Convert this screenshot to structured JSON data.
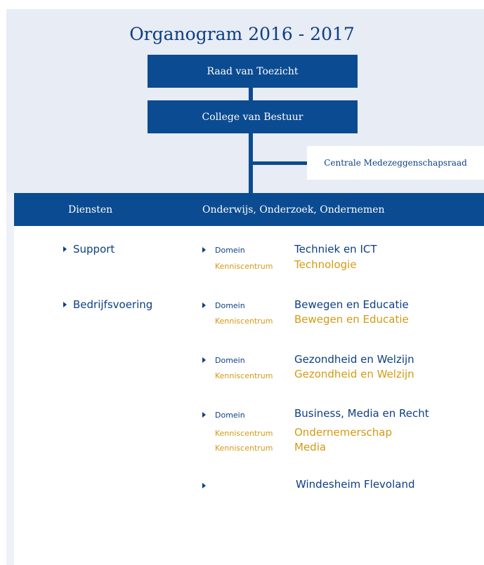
{
  "title": "Organogram 2016 - 2017",
  "boxes": {
    "raad": "Raad van Toezicht",
    "college": "College van Bestuur",
    "cmr": "Centrale Medezeggenschapsraad"
  },
  "band": {
    "left": "Diensten",
    "right": "Onderwijs, Onderzoek, Ondernemen"
  },
  "services": [
    "Support",
    "Bedrijfsvoering"
  ],
  "domains": [
    {
      "domain_label": "Domein",
      "domain_name": "Techniek en ICT",
      "kc": [
        {
          "label": "Kenniscentrum",
          "name": "Technologie"
        }
      ]
    },
    {
      "domain_label": "Domein",
      "domain_name": "Bewegen en Educatie",
      "kc": [
        {
          "label": "Kenniscentrum",
          "name": "Bewegen en Educatie"
        }
      ]
    },
    {
      "domain_label": "Domein",
      "domain_name": "Gezondheid en Welzijn",
      "kc": [
        {
          "label": "Kenniscentrum",
          "name": "Gezondheid en Welzijn"
        }
      ]
    },
    {
      "domain_label": "Domein",
      "domain_name": "Business, Media en Recht",
      "kc": [
        {
          "label": "Kenniscentrum",
          "name": "Ondernemerschap"
        },
        {
          "label": "Kenniscentrum",
          "name": "Media"
        }
      ]
    }
  ],
  "extra": {
    "name": "Windesheim Flevoland"
  },
  "colors": {
    "navy": "#0b4b91",
    "gold": "#d39a12",
    "text_navy": "#0d3f82"
  },
  "icons": {
    "bullet": "triangle-right-icon"
  }
}
